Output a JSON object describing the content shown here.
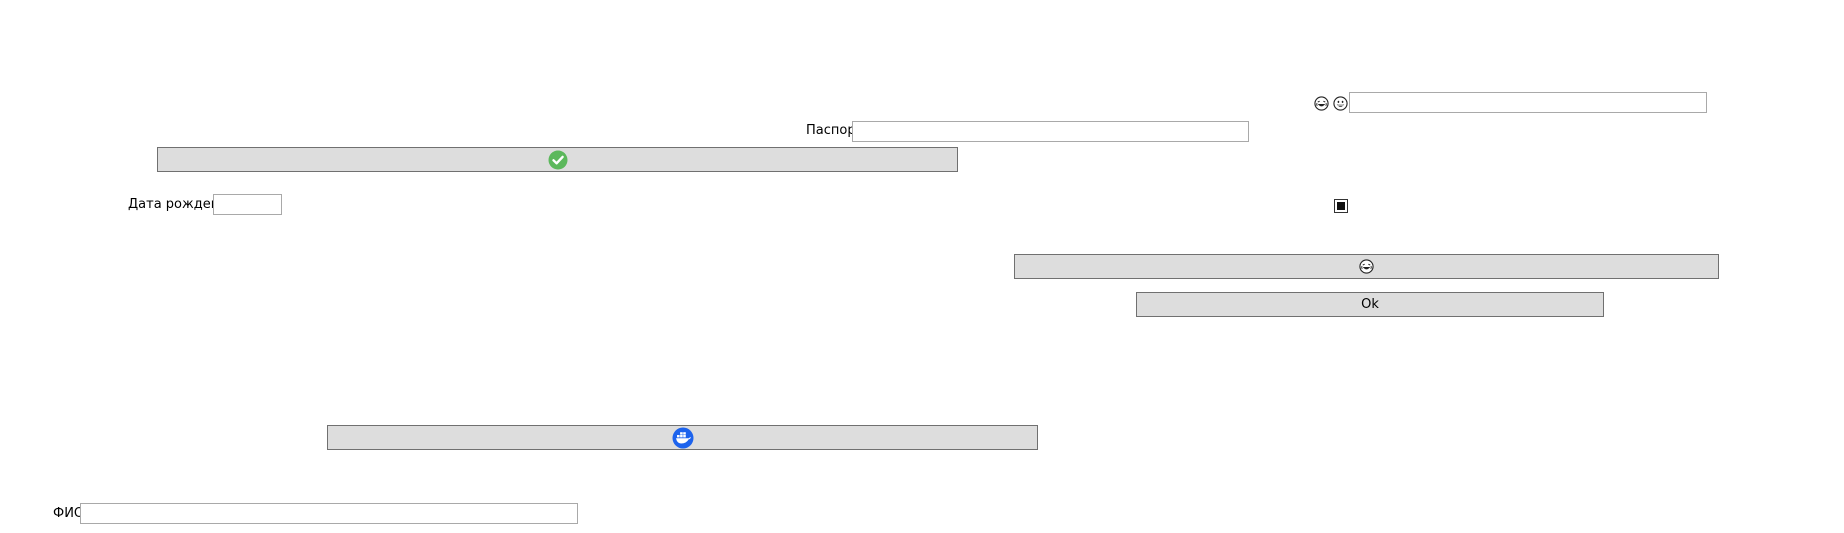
{
  "form": {
    "passport_label": "Паспорт",
    "birthdate_label": "Дата рождения",
    "fio_label": "ФИО",
    "ok_button_label": "Ok",
    "top_right_input_value": "",
    "passport_input_value": "",
    "birthdate_input_value": "",
    "fio_input_value": "",
    "checkbox_state": "indeterminate"
  },
  "icons": {
    "top_left_emoji": "laughing-face-icon",
    "top_right_emoji": "grinning-face-icon",
    "check_button_icon": "green-check-circle-icon",
    "emoji_button_icon": "laughing-face-icon",
    "docker_button_icon": "docker-whale-icon"
  },
  "colors": {
    "button_bg": "#dddddd",
    "check_green": "#5cb85c",
    "docker_blue": "#1d63ed"
  }
}
